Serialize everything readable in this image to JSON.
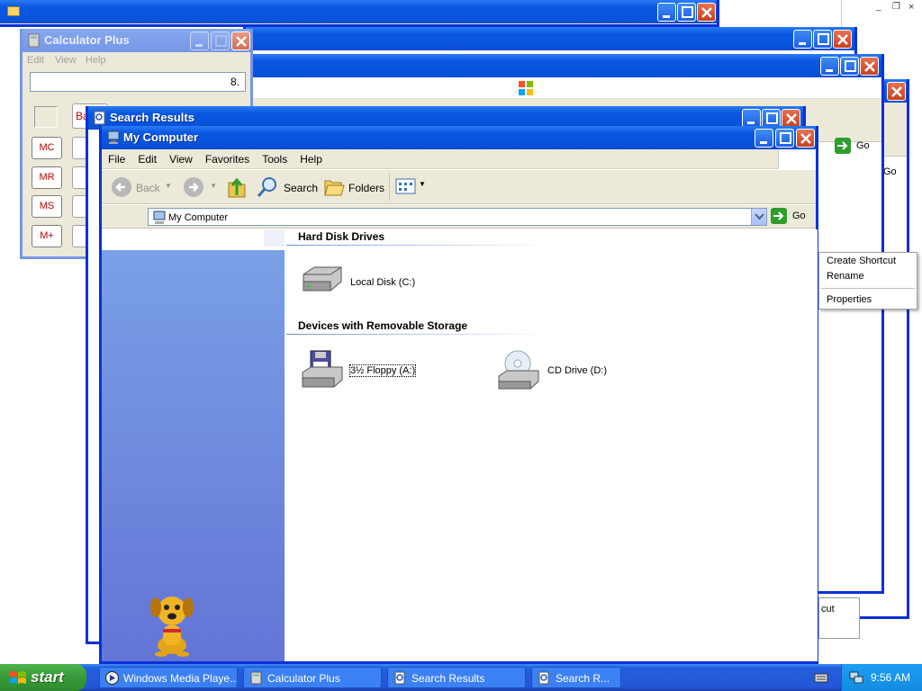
{
  "background_windows": {
    "top_window": {},
    "second_window": {},
    "third_window": {},
    "fourth_window": {
      "go_label": "Go"
    },
    "fifth_window": {
      "go_label": "Go"
    }
  },
  "calculator": {
    "title": "Calculator Plus",
    "menu": [
      "Edit",
      "View",
      "Help"
    ],
    "display": "8.",
    "backspace_partial": "Ba",
    "memory_buttons": [
      "MC",
      "MR",
      "MS",
      "M+"
    ]
  },
  "search_results": {
    "title": "Search Results"
  },
  "my_computer": {
    "title": "My Computer",
    "menu": [
      "File",
      "Edit",
      "View",
      "Favorites",
      "Tools",
      "Help"
    ],
    "toolbar": {
      "back": "Back",
      "search": "Search",
      "folders": "Folders"
    },
    "address": "My Computer",
    "go_label": "Go",
    "sections": [
      {
        "title": "Hard Disk Drives",
        "items": [
          "Local Disk (C:)"
        ]
      },
      {
        "title": "Devices with Removable Storage",
        "items": [
          "3½ Floppy (A:)",
          "CD Drive (D:)"
        ]
      }
    ]
  },
  "context_menu": {
    "items": [
      "Create Shortcut",
      "Rename",
      "Properties"
    ]
  },
  "partial_menu": {
    "text": "cut"
  },
  "taskbar": {
    "start_label": "start",
    "tasks": [
      "Windows Media Playe...",
      "Calculator Plus",
      "Search Results",
      "Search R..."
    ],
    "clock": "9:56 AM"
  },
  "colors": {
    "xp_blue": "#0831d9",
    "taskbar": "#245edb",
    "start_green": "#379a37"
  }
}
